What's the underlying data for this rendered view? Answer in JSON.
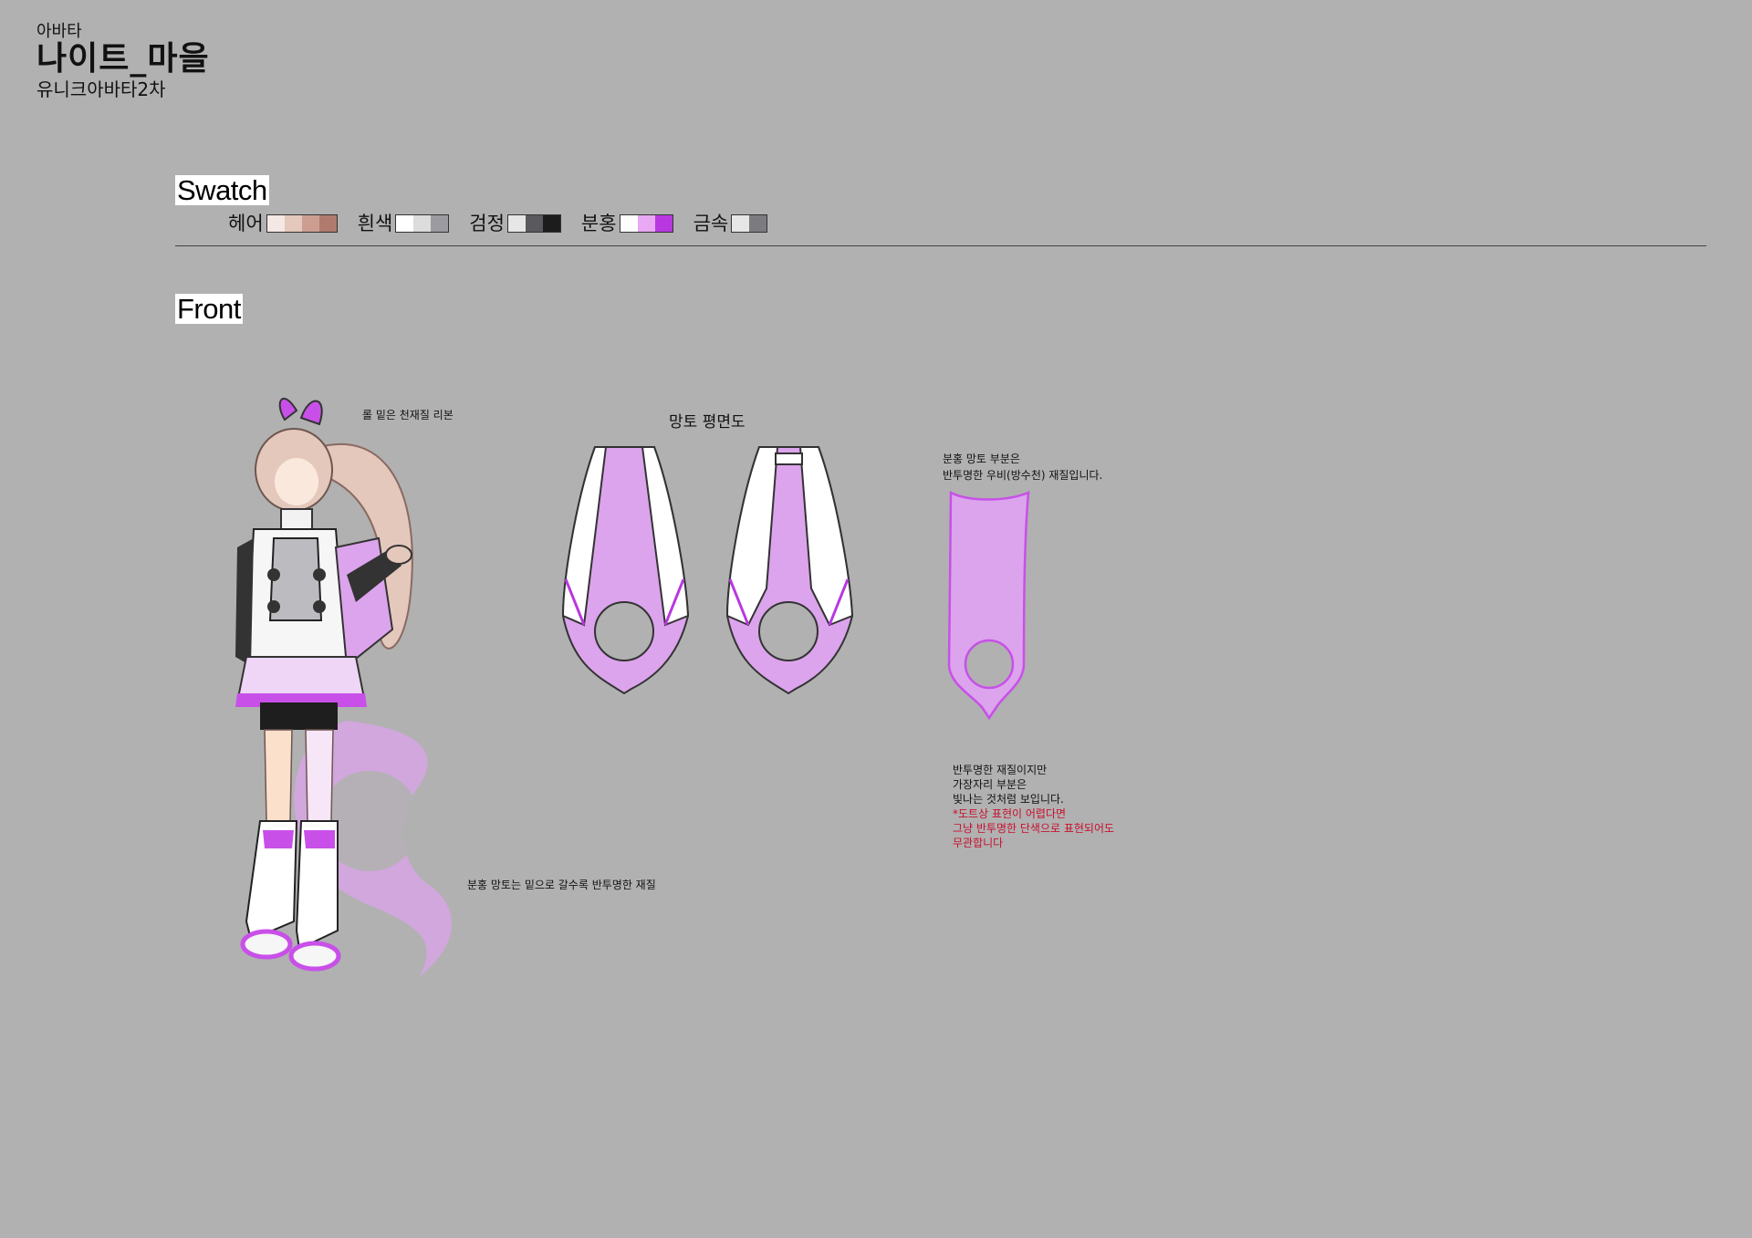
{
  "header": {
    "category": "아바타",
    "title": "나이트_마을",
    "subtitle": "유니크아바타2차"
  },
  "sections": {
    "swatch": "Swatch",
    "front": "Front"
  },
  "swatches": [
    {
      "name": "헤어",
      "colors": [
        "#f4e8e4",
        "#e4c8bc",
        "#cc9e92",
        "#b07a6e"
      ]
    },
    {
      "name": "흰색",
      "colors": [
        "#ffffff",
        "#dcdcdc",
        "#9a9aa0"
      ]
    },
    {
      "name": "검정",
      "colors": [
        "#e6e6e6",
        "#5a5a5e",
        "#1c1c1c"
      ]
    },
    {
      "name": "분홍",
      "colors": [
        "#ffffff",
        "#e8a8f4",
        "#b838e0"
      ]
    },
    {
      "name": "금속",
      "colors": [
        "#e6e6e6",
        "#7c7c80"
      ]
    }
  ],
  "annotations": {
    "ribbon": "롤 밑은 천재질 리본",
    "cape_flat_title": "망토 평면도",
    "pink_cape_part": "분홍 망토 부분은",
    "pink_cape_material": "반투명한 우비(방수천) 재질입니다.",
    "cape_bottom": "분홍 망토는 밑으로 갈수록 반투명한 재질",
    "edge_note": [
      "반투명한 재질이지만",
      "가장자리 부분은",
      "빛나는 것처럼 보입니다."
    ],
    "edge_note_red": [
      "*도트상 표현이 어렵다면",
      "그냥 반투명한 단색으로 표현되어도",
      "무관합니다"
    ]
  },
  "colors": {
    "background": "#b1b1b1",
    "accent_pink": "#b838e0",
    "cape_fill": "#dca4ec",
    "note_red": "#c8102e"
  }
}
